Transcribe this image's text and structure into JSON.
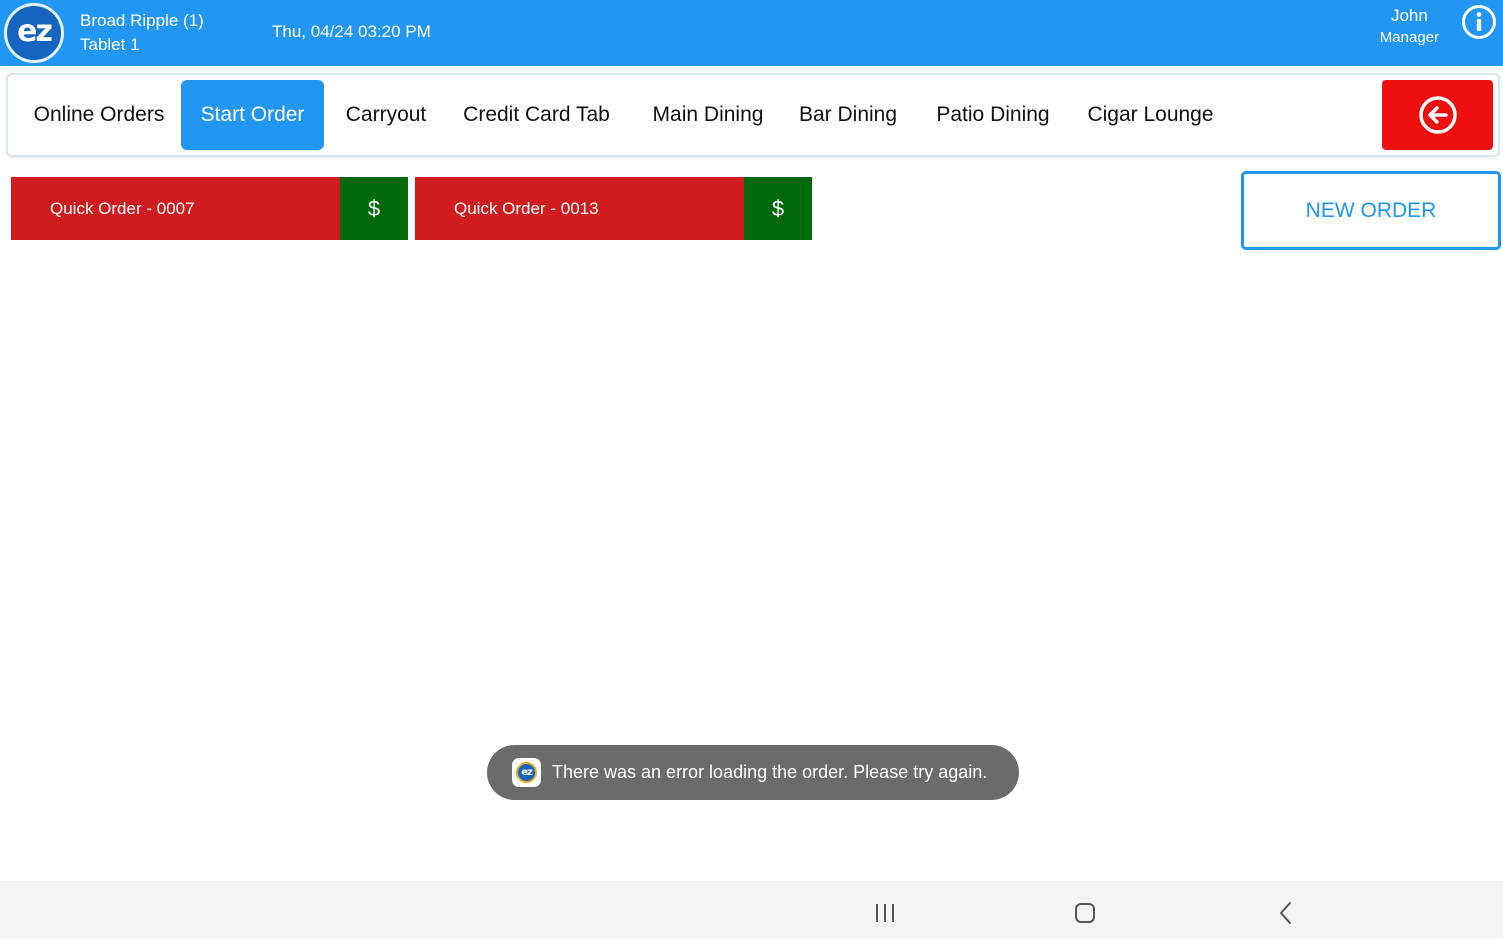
{
  "header": {
    "logo_text": "ez",
    "store_name": "Broad Ripple (1)",
    "device": "Tablet 1",
    "datetime": "Thu, 04/24 03:20 PM",
    "user_name": "John",
    "user_role": "Manager",
    "info_icon": "info-circle-icon",
    "background_color": "#2196f3"
  },
  "tabs": [
    {
      "label": "Online Orders",
      "active": false
    },
    {
      "label": "Start Order",
      "active": true
    },
    {
      "label": "Carryout",
      "active": false
    },
    {
      "label": "Credit Card Tab",
      "active": false
    },
    {
      "label": "Main Dining",
      "active": false
    },
    {
      "label": "Bar Dining",
      "active": false
    },
    {
      "label": "Patio Dining",
      "active": false
    },
    {
      "label": "Cigar Lounge",
      "active": false
    }
  ],
  "back_button": {
    "icon": "arrow-left-circle-icon",
    "color": "#ef0f0f"
  },
  "orders": [
    {
      "label": "Quick Order - 0007",
      "pay_label": "$"
    },
    {
      "label": "Quick Order - 0013",
      "pay_label": "$"
    }
  ],
  "order_colors": {
    "main": "#d01c1f",
    "pay": "#00690b"
  },
  "new_order_label": "NEW ORDER",
  "toast": {
    "icon": "ez-app-icon",
    "icon_text": "ez",
    "message": "There was an error loading the order. Please try again."
  },
  "system_nav": {
    "recents_icon": "recents-icon",
    "home_icon": "home-icon",
    "back_icon": "back-chevron-icon"
  }
}
